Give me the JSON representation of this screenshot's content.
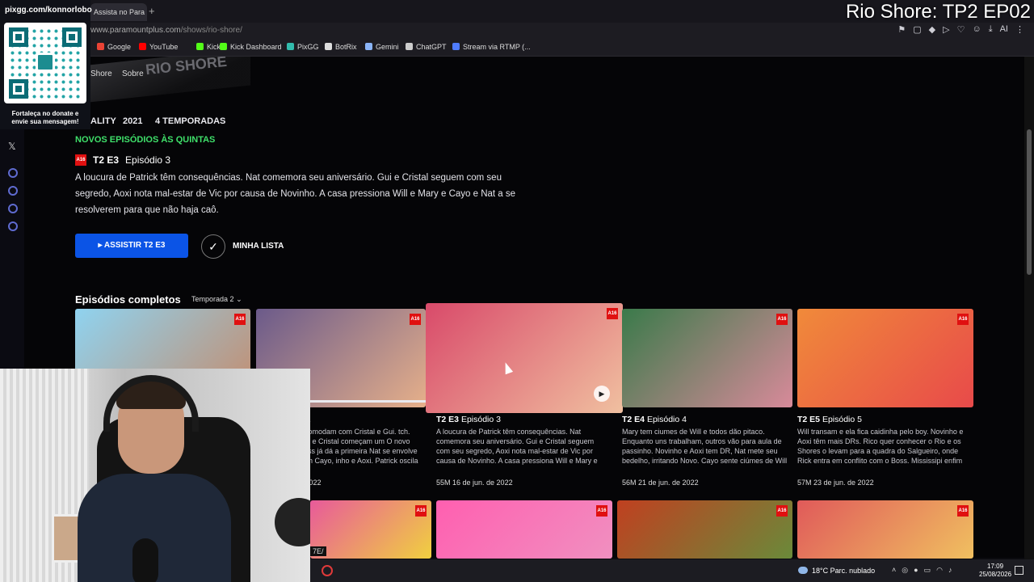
{
  "browser": {
    "tab_title": "Assista no Para",
    "new_tab": "+",
    "url_host": "www.paramountplus.com",
    "url_path": "/shows/rio-shore/",
    "bookmarks": [
      {
        "label": "Google",
        "color": "#ea4335"
      },
      {
        "label": "YouTube",
        "color": "#ff0000"
      },
      {
        "label": "Kick",
        "color": "#53fc18"
      },
      {
        "label": "Kick Dashboard",
        "color": "#53fc18"
      },
      {
        "label": "PixGG",
        "color": "#32bcad"
      },
      {
        "label": "BotRix",
        "color": "#dddddd"
      },
      {
        "label": "Gemini",
        "color": "#8ab4f8"
      },
      {
        "label": "ChatGPT",
        "color": "#cccccc"
      },
      {
        "label": "Stream via RTMP (...",
        "color": "#4f7cff"
      }
    ],
    "ai_label": "AI"
  },
  "overlay": {
    "stream_title": "Rio Shore: TP2 EP02",
    "qr_handle": "pixgg.com/konnorlobo",
    "qr_caption": "Fortaleça no donate e envie sua mensagem!",
    "partial_url": "7E/"
  },
  "show": {
    "logo_fragment": "RIO SHORE",
    "nav": [
      "Shore",
      "Sobre"
    ],
    "genre": "ALITY",
    "year": "2021",
    "seasons": "4 TEMPORADAS",
    "new_episodes": "NOVOS EPISÓDIOS ÀS QUINTAS",
    "rating": "A16",
    "current_code": "T2 E3",
    "current_name": "Episódio 3",
    "description": "A loucura de Patrick têm consequências. Nat comemora seu aniversário. Gui e Cristal seguem com seu segredo, Aoxi nota mal-estar de Vic por causa de Novinho. A casa pressiona Will e Mary e Cayo e Nat a se resolverem para que não haja caô.",
    "watch_button": "ASSISTIR T2 E3",
    "list_button": "MINHA LISTA"
  },
  "episodes_section": {
    "title": "Episódios completos",
    "season_select": "Temporada 2",
    "cards": [
      {
        "code": "",
        "name": "",
        "desc": "",
        "meta": "",
        "colors": [
          "#8fd3f0",
          "#c58a6a"
        ]
      },
      {
        "code": "",
        "name": "o 2",
        "desc": "incomodam com Cristal e Gui. tch. Gui e Cristal começam um O novo Boss já dá a primeira Nat se envolve com Cayo, inho e Aoxi. Patrick oscila entre...",
        "meta": "e 2022",
        "colors": [
          "#6b5a8a",
          "#e6b08a"
        ]
      },
      {
        "code": "T2 E3",
        "name": "Episódio 3",
        "desc": "A loucura de Patrick têm consequências. Nat comemora seu aniversário. Gui e Cristal seguem com seu segredo, Aoxi nota mal-estar de Vic por causa de Novinho. A casa pressiona Will e Mary e Cayo e Nat a se resolverem para que não haj...",
        "meta": "55M  16 de jun. de 2022",
        "colors": [
          "#d94a6a",
          "#f0c0a0"
        ]
      },
      {
        "code": "T2 E4",
        "name": "Episódio 4",
        "desc": "Mary tem ciumes de Will e todos dão pitaco. Enquanto uns trabalham, outros vão para aula de passinho. Novinho e Aoxi tem DR, Nat mete seu bedelho, irritando Novo. Cayo sente ciúmes de Will e Nat e a família curte um show da Turma d...",
        "meta": "56M  21 de jun. de 2022",
        "colors": [
          "#3a7a4a",
          "#d88a9a"
        ]
      },
      {
        "code": "T2 E5",
        "name": "Episódio 5",
        "desc": "Will transam e ela fica caidinha pelo boy. Novinho e Aoxi têm mais DRs. Rico quer conhecer o Rio e os Shores o levam para a quadra do Salgueiro, onde Rick entra em conflito com o Boss. Mississipi enfim chega, causando horrores.",
        "meta": "57M  23 de jun. de 2022",
        "colors": [
          "#f08a3a",
          "#e84a4a"
        ]
      }
    ],
    "bottom_row_colors": [
      [
        "#e85a9a",
        "#f0d040"
      ],
      [
        "#ff5fb0",
        "#f090c0"
      ],
      [
        "#c04020",
        "#6a8a3a"
      ],
      [
        "#e05a5a",
        "#f0c060"
      ]
    ]
  },
  "taskbar": {
    "weather": "18°C  Parc. nublado",
    "time": "17:09",
    "date": "25/08/2026"
  }
}
